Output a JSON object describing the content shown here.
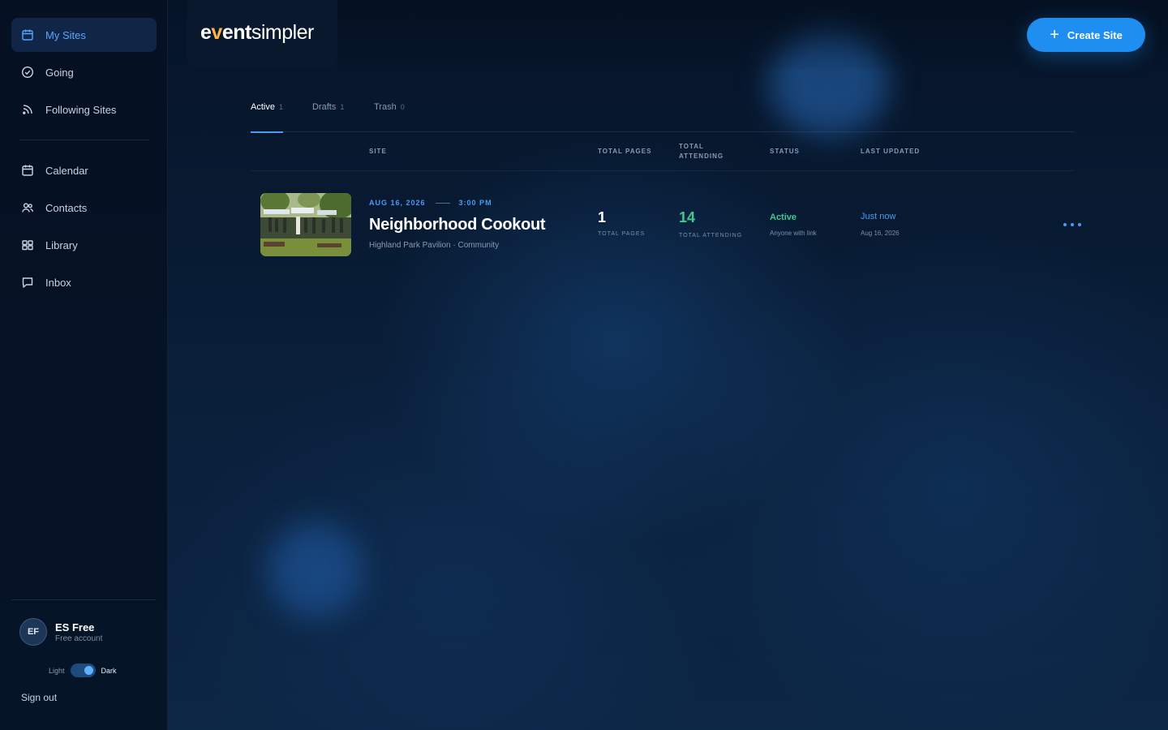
{
  "app": {
    "logo_event": "event",
    "logo_simpler": "simpler",
    "create_button": "Create Site"
  },
  "sidebar": {
    "primary": [
      {
        "label": "My Sites",
        "icon": "calendar-icon",
        "active": true
      },
      {
        "label": "Going",
        "icon": "check-circle-icon"
      },
      {
        "label": "Following Sites",
        "icon": "rss-icon"
      }
    ],
    "secondary": [
      {
        "label": "Calendar",
        "icon": "calendar-icon"
      },
      {
        "label": "Contacts",
        "icon": "users-icon"
      },
      {
        "label": "Library",
        "icon": "grid-icon"
      },
      {
        "label": "Inbox",
        "icon": "message-icon"
      }
    ],
    "account": {
      "initials": "EF",
      "name": "ES Free",
      "plan": "Free account"
    },
    "theme": {
      "light": "Light",
      "dark": "Dark",
      "selected": "Dark"
    },
    "sign_out": "Sign out"
  },
  "tabs": [
    {
      "label": "Active",
      "count": "1",
      "active": true
    },
    {
      "label": "Drafts",
      "count": "1"
    },
    {
      "label": "Trash",
      "count": "0"
    }
  ],
  "table": {
    "headers": {
      "site": "SITE",
      "total_pages": "TOTAL PAGES",
      "total_attending": "TOTAL ATTENDING",
      "status": "STATUS",
      "last_updated": "LAST UPDATED"
    },
    "rows": [
      {
        "date": "AUG 16, 2026",
        "time": "3:00 PM",
        "title": "Neighborhood Cookout",
        "subtitle": "Highland Park Pavilion · Community",
        "total_pages": "1",
        "total_pages_label": "TOTAL PAGES",
        "total_attending": "14",
        "total_attending_label": "TOTAL ATTENDING",
        "status": "Active",
        "status_sub": "Anyone with link",
        "updated": "Just now",
        "updated_sub": "Aug 16, 2026"
      }
    ]
  },
  "colors": {
    "accent": "#1e8ff0",
    "link": "#4a9bf5",
    "success": "#3ecb8e",
    "background": "#07182d"
  }
}
